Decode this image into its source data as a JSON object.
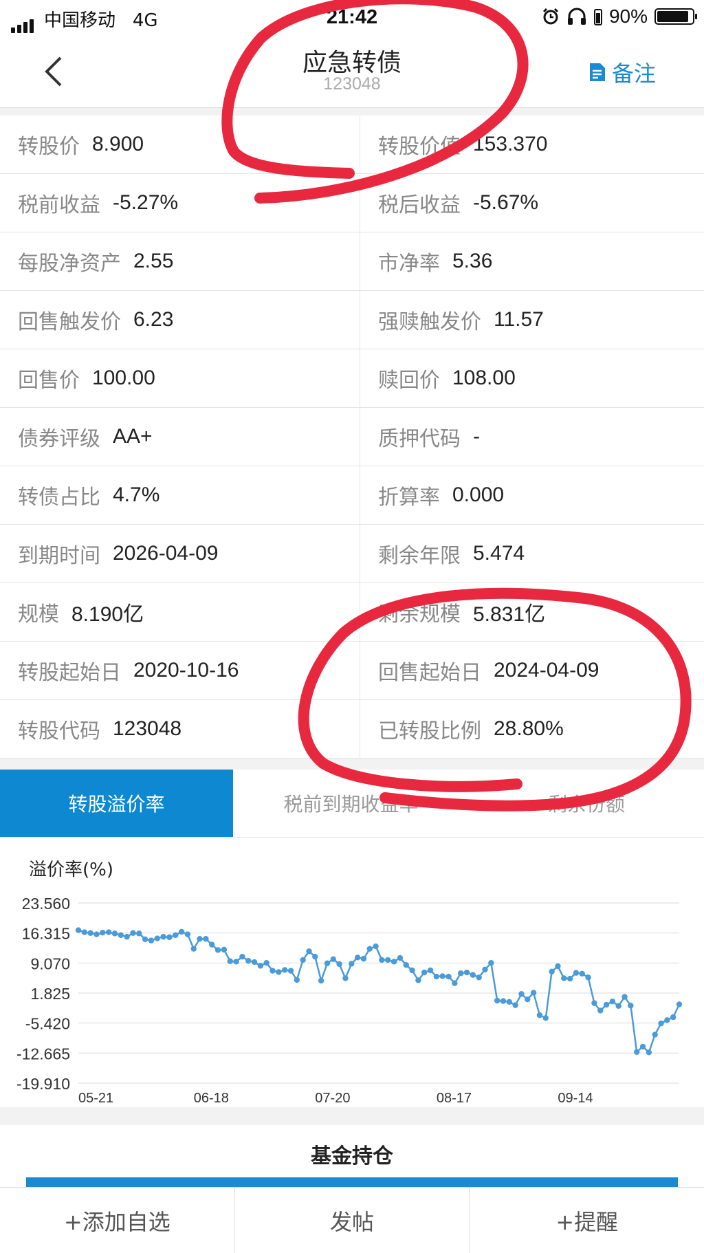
{
  "status_bar": {
    "carrier": "中国移动",
    "network": "4G",
    "time": "21:42",
    "battery": "90%",
    "battery_level": 0.9,
    "icons": [
      "signal-icon",
      "alarm-icon",
      "headphones-icon",
      "battery-icon"
    ]
  },
  "nav": {
    "title": "应急转债",
    "code": "123048",
    "note_label": "备注",
    "back_icon": "chevron-left-icon",
    "note_icon": "note-icon"
  },
  "info_rows": [
    [
      {
        "label": "转股价",
        "value": "8.900"
      },
      {
        "label": "转股价值",
        "value": "153.370"
      }
    ],
    [
      {
        "label": "税前收益",
        "value": "-5.27%"
      },
      {
        "label": "税后收益",
        "value": "-5.67%"
      }
    ],
    [
      {
        "label": "每股净资产",
        "value": "2.55"
      },
      {
        "label": "市净率",
        "value": "5.36"
      }
    ],
    [
      {
        "label": "回售触发价",
        "value": "6.23"
      },
      {
        "label": "强赎触发价",
        "value": "11.57"
      }
    ],
    [
      {
        "label": "回售价",
        "value": "100.00"
      },
      {
        "label": "赎回价",
        "value": "108.00"
      }
    ],
    [
      {
        "label": "债券评级",
        "value": "AA+"
      },
      {
        "label": "质押代码",
        "value": "-"
      }
    ],
    [
      {
        "label": "转债占比",
        "value": "4.7%"
      },
      {
        "label": "折算率",
        "value": "0.000"
      }
    ],
    [
      {
        "label": "到期时间",
        "value": "2026-04-09"
      },
      {
        "label": "剩余年限",
        "value": "5.474"
      }
    ],
    [
      {
        "label": "规模",
        "value": "8.190亿"
      },
      {
        "label": "剩余规模",
        "value": "5.831亿"
      }
    ],
    [
      {
        "label": "转股起始日",
        "value": "2020-10-16"
      },
      {
        "label": "回售起始日",
        "value": "2024-04-09"
      }
    ],
    [
      {
        "label": "转股代码",
        "value": "123048"
      },
      {
        "label": "已转股比例",
        "value": "28.80%"
      }
    ]
  ],
  "tabs": [
    {
      "label": "转股溢价率",
      "active": true
    },
    {
      "label": "税前到期收益率",
      "active": false
    },
    {
      "label": "剩余份额",
      "active": false
    }
  ],
  "chart_data": {
    "type": "line",
    "ylabel": "溢价率(%)",
    "yticks": [
      "23.560",
      "16.315",
      "9.070",
      "1.825",
      "-5.420",
      "-12.665",
      "-19.910"
    ],
    "ylim": [
      -19.91,
      23.56
    ],
    "xticks": [
      {
        "label": "05-21",
        "index": 0
      },
      {
        "label": "06-18",
        "index": 19
      },
      {
        "label": "07-20",
        "index": 39
      },
      {
        "label": "08-17",
        "index": 59
      },
      {
        "label": "09-14",
        "index": 79
      }
    ],
    "grid": true,
    "color": "#4a9bd8",
    "values": [
      17.0,
      16.5,
      16.3,
      16.0,
      16.4,
      16.5,
      16.2,
      15.8,
      15.4,
      16.3,
      16.2,
      14.8,
      14.5,
      15.0,
      15.4,
      15.3,
      15.8,
      16.6,
      16.0,
      12.5,
      14.9,
      14.9,
      13.5,
      12.2,
      12.3,
      9.5,
      9.4,
      10.6,
      9.6,
      9.3,
      8.4,
      9.1,
      7.2,
      6.9,
      7.4,
      7.2,
      5.0,
      9.8,
      11.9,
      10.6,
      4.8,
      9.0,
      10.0,
      8.8,
      5.4,
      8.9,
      10.4,
      10.1,
      12.5,
      13.1,
      9.8,
      9.8,
      9.4,
      10.3,
      8.6,
      7.3,
      4.9,
      6.8,
      7.3,
      5.8,
      5.9,
      5.8,
      4.2,
      6.6,
      6.8,
      6.2,
      5.6,
      7.5,
      9.1,
      0.0,
      -0.1,
      -0.3,
      -1.1,
      1.6,
      0.3,
      1.9,
      -3.5,
      -4.2,
      7.0,
      8.3,
      5.4,
      5.3,
      6.7,
      6.5,
      5.6,
      -0.6,
      -2.4,
      -1.0,
      -0.2,
      -1.3,
      0.9,
      -1.2,
      -12.4,
      -11.1,
      -12.5,
      -8.2,
      -5.5,
      -4.7,
      -4.0,
      -0.9
    ]
  },
  "fund": {
    "heading": "基金持仓"
  },
  "bottom_bar": {
    "add_watch": "+添加自选",
    "post": "发帖",
    "remind": "+提醒"
  },
  "annotation_color": "#e8283e"
}
